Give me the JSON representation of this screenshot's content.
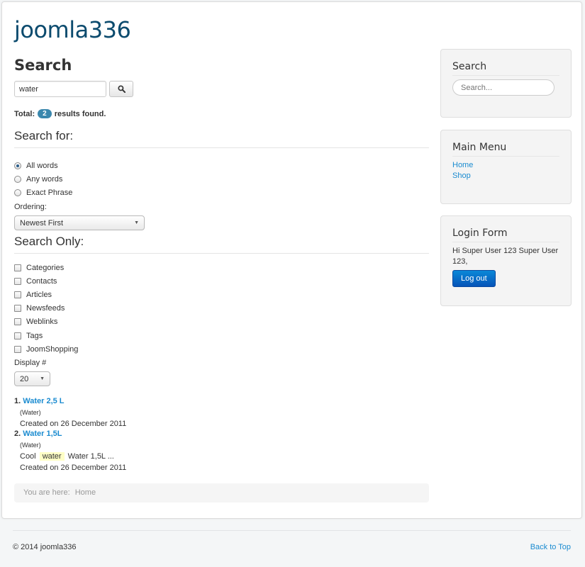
{
  "site": {
    "title": "joomla336"
  },
  "main": {
    "heading": "Search",
    "search": {
      "value": "water",
      "button_icon": "search-icon"
    },
    "total": {
      "prefix": "Total:",
      "count": "2",
      "suffix": "results found."
    },
    "search_for": {
      "title": "Search for:",
      "options": [
        {
          "label": "All words",
          "checked": true
        },
        {
          "label": "Any words",
          "checked": false
        },
        {
          "label": "Exact Phrase",
          "checked": false
        }
      ],
      "ordering_label": "Ordering:",
      "ordering_value": "Newest First"
    },
    "search_only": {
      "title": "Search Only:",
      "areas": [
        "Categories",
        "Contacts",
        "Articles",
        "Newsfeeds",
        "Weblinks",
        "Tags",
        "JoomShopping"
      ]
    },
    "display": {
      "label": "Display #",
      "value": "20"
    },
    "results": [
      {
        "num": "1.",
        "title": "Water 2,5 L",
        "category": "(Water)",
        "text_before": "",
        "highlight": "",
        "text_after": "",
        "created": "Created on 26 December 2011"
      },
      {
        "num": "2.",
        "title": "Water 1,5L",
        "category": "(Water)",
        "text_before": "Cool",
        "highlight": "water",
        "text_after": "Water 1,5L  ...",
        "created": "Created on 26 December 2011"
      }
    ],
    "breadcrumb": {
      "prefix": "You are here:",
      "current": "Home"
    }
  },
  "sidebar": {
    "search_module": {
      "title": "Search",
      "placeholder": "Search..."
    },
    "menu_module": {
      "title": "Main Menu",
      "items": [
        "Home",
        "Shop"
      ]
    },
    "login_module": {
      "title": "Login Form",
      "greeting": "Hi Super User 123 Super User 123,",
      "button": "Log out"
    }
  },
  "footer": {
    "copyright": "© 2014 joomla336",
    "back_to_top": "Back to Top"
  },
  "colors": {
    "link": "#1a8bd0",
    "title": "#0c4b6e",
    "badge": "#3a87ad",
    "logout": "#0654b8"
  }
}
